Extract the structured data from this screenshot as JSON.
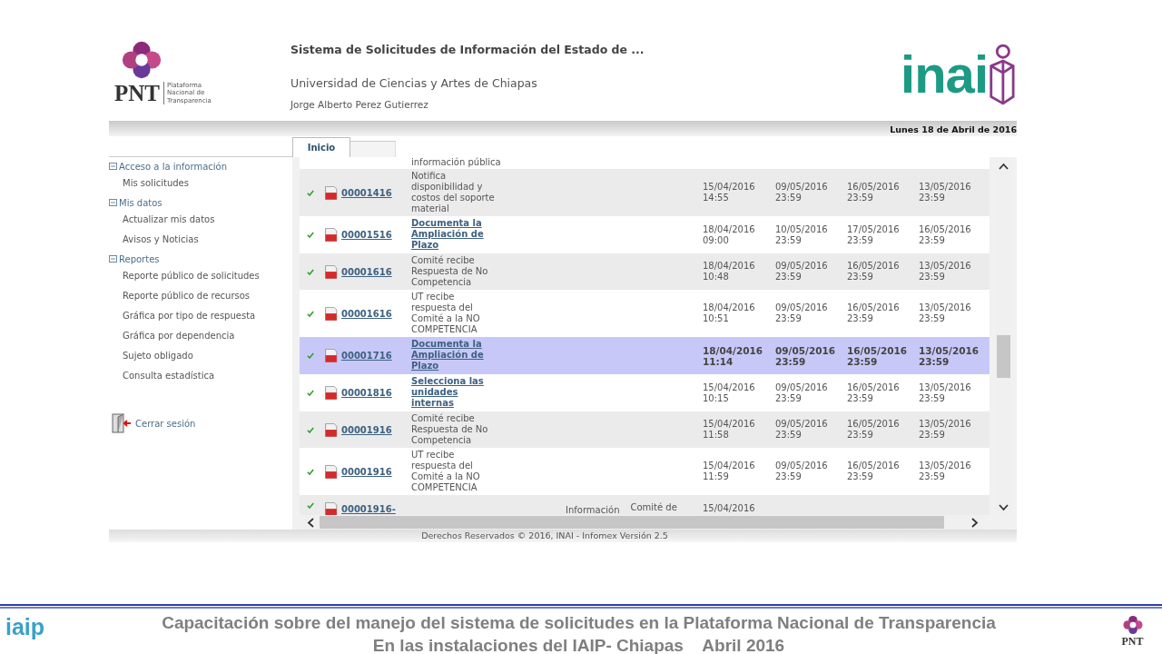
{
  "header": {
    "pnt_logo": {
      "brand": "PNT",
      "caption": [
        "Plataforma",
        "Nacional de",
        "Transparencia"
      ]
    },
    "title": "Sistema de Solicitudes de Información del Estado de ...",
    "institution": "Universidad de Ciencias y Artes de Chiapas",
    "user": "Jorge Alberto Perez Gutierrez",
    "inai_logo": "inai"
  },
  "date_bar": "Lunes 18 de Abril de 2016",
  "tabs": [
    {
      "label": "Inicio",
      "selected": true
    }
  ],
  "sidebar": {
    "items": [
      {
        "kind": "section",
        "label": "Acceso a la información"
      },
      {
        "kind": "link",
        "label": "Mis solicitudes"
      },
      {
        "kind": "section",
        "label": "Mis datos"
      },
      {
        "kind": "link",
        "label": "Actualizar mis datos"
      },
      {
        "kind": "link",
        "label": "Avisos y Noticias"
      },
      {
        "kind": "section",
        "label": "Reportes"
      },
      {
        "kind": "link",
        "label": "Reporte público de solicitudes"
      },
      {
        "kind": "link",
        "label": "Reporte público de recursos"
      },
      {
        "kind": "link",
        "label": "Gráfica por tipo de respuesta"
      },
      {
        "kind": "link",
        "label": "Gráfica por dependencia"
      },
      {
        "kind": "link",
        "label": "Sujeto obligado"
      },
      {
        "kind": "link",
        "label": "Consulta estadística"
      }
    ],
    "logout": "Cerrar sesión"
  },
  "table": {
    "rows": [
      {
        "kind": "clipped_top",
        "status": "información pública"
      },
      {
        "kind": "full",
        "folio": "00001416",
        "status": "Notifica disponibilidad y costos del soporte material",
        "status_link": false,
        "selected": false,
        "dates": [
          [
            "15/04/2016",
            "14:55"
          ],
          [
            "09/05/2016",
            "23:59"
          ],
          [
            "16/05/2016",
            "23:59"
          ],
          [
            "13/05/2016",
            "23:59"
          ]
        ]
      },
      {
        "kind": "full",
        "folio": "00001516",
        "status": "Documenta la Ampliación de Plazo",
        "status_link": true,
        "selected": false,
        "dates": [
          [
            "18/04/2016",
            "09:00"
          ],
          [
            "10/05/2016",
            "23:59"
          ],
          [
            "17/05/2016",
            "23:59"
          ],
          [
            "16/05/2016",
            "23:59"
          ]
        ]
      },
      {
        "kind": "full",
        "folio": "00001616",
        "status": "Comité recibe Respuesta de No Competencia",
        "status_link": false,
        "selected": false,
        "dates": [
          [
            "18/04/2016",
            "10:48"
          ],
          [
            "09/05/2016",
            "23:59"
          ],
          [
            "16/05/2016",
            "23:59"
          ],
          [
            "13/05/2016",
            "23:59"
          ]
        ]
      },
      {
        "kind": "full",
        "folio": "00001616",
        "status": "UT recibe respuesta del Comité a la NO COMPETENCIA",
        "status_link": false,
        "selected": false,
        "dates": [
          [
            "18/04/2016",
            "10:51"
          ],
          [
            "09/05/2016",
            "23:59"
          ],
          [
            "16/05/2016",
            "23:59"
          ],
          [
            "13/05/2016",
            "23:59"
          ]
        ]
      },
      {
        "kind": "full",
        "folio": "00001716",
        "status": "Documenta la Ampliación de Plazo",
        "status_link": true,
        "selected": true,
        "dates": [
          [
            "18/04/2016",
            "11:14"
          ],
          [
            "09/05/2016",
            "23:59"
          ],
          [
            "16/05/2016",
            "23:59"
          ],
          [
            "13/05/2016",
            "23:59"
          ]
        ]
      },
      {
        "kind": "full",
        "folio": "00001816",
        "status": "Selecciona las unidades internas",
        "status_link": true,
        "selected": false,
        "dates": [
          [
            "15/04/2016",
            "10:15"
          ],
          [
            "09/05/2016",
            "23:59"
          ],
          [
            "16/05/2016",
            "23:59"
          ],
          [
            "13/05/2016",
            "23:59"
          ]
        ]
      },
      {
        "kind": "full",
        "folio": "00001916",
        "status": "Comité recibe Respuesta de No Competencia",
        "status_link": false,
        "selected": false,
        "dates": [
          [
            "15/04/2016",
            "11:58"
          ],
          [
            "09/05/2016",
            "23:59"
          ],
          [
            "16/05/2016",
            "23:59"
          ],
          [
            "13/05/2016",
            "23:59"
          ]
        ]
      },
      {
        "kind": "full",
        "folio": "00001916",
        "status": "UT recibe respuesta del Comité a la NO COMPETENCIA",
        "status_link": false,
        "selected": false,
        "dates": [
          [
            "15/04/2016",
            "11:59"
          ],
          [
            "09/05/2016",
            "23:59"
          ],
          [
            "16/05/2016",
            "23:59"
          ],
          [
            "13/05/2016",
            "23:59"
          ]
        ]
      },
      {
        "kind": "clipped_bottom",
        "folio": "00001916-",
        "column_a": "Información",
        "column_b": "Comité de",
        "date": "15/04/2016"
      }
    ]
  },
  "footer": "Derechos Reservados © 2016, INAI - Infomex Versión 2.5",
  "slide": {
    "iaip_logo": "iaip",
    "caption": [
      "Capacitación sobre del manejo del sistema de solicitudes en la Plataforma Nacional de Transparencia",
      "En las instalaciones del IAIP- Chiapas    Abril 2016"
    ],
    "pnt_logo": "PNT"
  }
}
